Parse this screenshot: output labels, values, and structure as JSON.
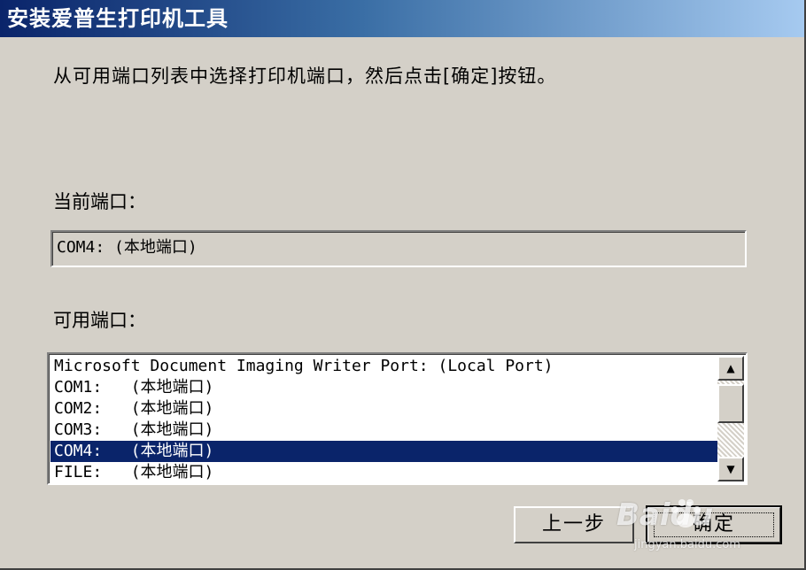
{
  "window": {
    "title": "安装爱普生打印机工具"
  },
  "instruction": "从可用端口列表中选择打印机端口，然后点击[确定]按钮。",
  "current_port": {
    "label": "当前端口：",
    "value": "COM4: (本地端口)"
  },
  "available_ports": {
    "label": "可用端口：",
    "items": [
      "Microsoft Document Imaging Writer Port: (Local Port)",
      "COM1:   (本地端口)",
      "COM2:   (本地端口)",
      "COM3:   (本地端口)",
      "COM4:   (本地端口)",
      "FILE:   (本地端口)"
    ],
    "selected_index": 4
  },
  "buttons": {
    "back": "上一步",
    "ok": "确定"
  },
  "watermark": {
    "main": "Baidu",
    "sub": "jingyan.baidu.com"
  },
  "colors": {
    "dialog_bg": "#d4d0c8",
    "title_bar": "#0a246a",
    "selection": "#0a246a"
  }
}
